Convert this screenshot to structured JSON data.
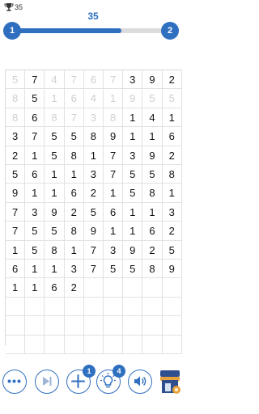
{
  "header": {
    "best_score": "35",
    "current_score": "35",
    "progress": 0.69,
    "level_left": "1",
    "level_right": "2"
  },
  "board": {
    "rows": [
      [
        [
          "5",
          0
        ],
        [
          "7",
          1
        ],
        [
          "4",
          0
        ],
        [
          "7",
          0
        ],
        [
          "6",
          0
        ],
        [
          "7",
          0
        ],
        [
          "3",
          1
        ],
        [
          "9",
          1
        ],
        [
          "2",
          1
        ]
      ],
      [
        [
          "8",
          0
        ],
        [
          "5",
          1
        ],
        [
          "1",
          0
        ],
        [
          "6",
          0
        ],
        [
          "4",
          0
        ],
        [
          "1",
          0
        ],
        [
          "9",
          0
        ],
        [
          "5",
          0
        ],
        [
          "5",
          0
        ]
      ],
      [
        [
          "8",
          0
        ],
        [
          "6",
          1
        ],
        [
          "8",
          0
        ],
        [
          "7",
          0
        ],
        [
          "3",
          0
        ],
        [
          "8",
          0
        ],
        [
          "1",
          1
        ],
        [
          "4",
          1
        ],
        [
          "1",
          1
        ]
      ],
      [
        [
          "3",
          1
        ],
        [
          "7",
          1
        ],
        [
          "5",
          1
        ],
        [
          "5",
          1
        ],
        [
          "8",
          1
        ],
        [
          "9",
          1
        ],
        [
          "1",
          1
        ],
        [
          "1",
          1
        ],
        [
          "6",
          1
        ]
      ],
      [
        [
          "2",
          1
        ],
        [
          "1",
          1
        ],
        [
          "5",
          1
        ],
        [
          "8",
          1
        ],
        [
          "1",
          1
        ],
        [
          "7",
          1
        ],
        [
          "3",
          1
        ],
        [
          "9",
          1
        ],
        [
          "2",
          1
        ]
      ],
      [
        [
          "5",
          1
        ],
        [
          "6",
          1
        ],
        [
          "1",
          1
        ],
        [
          "1",
          1
        ],
        [
          "3",
          1
        ],
        [
          "7",
          1
        ],
        [
          "5",
          1
        ],
        [
          "5",
          1
        ],
        [
          "8",
          1
        ]
      ],
      [
        [
          "9",
          1
        ],
        [
          "1",
          1
        ],
        [
          "1",
          1
        ],
        [
          "6",
          1
        ],
        [
          "2",
          1
        ],
        [
          "1",
          1
        ],
        [
          "5",
          1
        ],
        [
          "8",
          1
        ],
        [
          "1",
          1
        ]
      ],
      [
        [
          "7",
          1
        ],
        [
          "3",
          1
        ],
        [
          "9",
          1
        ],
        [
          "2",
          1
        ],
        [
          "5",
          1
        ],
        [
          "6",
          1
        ],
        [
          "1",
          1
        ],
        [
          "1",
          1
        ],
        [
          "3",
          1
        ]
      ],
      [
        [
          "7",
          1
        ],
        [
          "5",
          1
        ],
        [
          "5",
          1
        ],
        [
          "8",
          1
        ],
        [
          "9",
          1
        ],
        [
          "1",
          1
        ],
        [
          "1",
          1
        ],
        [
          "6",
          1
        ],
        [
          "2",
          1
        ]
      ],
      [
        [
          "1",
          1
        ],
        [
          "5",
          1
        ],
        [
          "8",
          1
        ],
        [
          "1",
          1
        ],
        [
          "7",
          1
        ],
        [
          "3",
          1
        ],
        [
          "9",
          1
        ],
        [
          "2",
          1
        ],
        [
          "5",
          1
        ]
      ],
      [
        [
          "6",
          1
        ],
        [
          "1",
          1
        ],
        [
          "1",
          1
        ],
        [
          "3",
          1
        ],
        [
          "7",
          1
        ],
        [
          "5",
          1
        ],
        [
          "5",
          1
        ],
        [
          "8",
          1
        ],
        [
          "9",
          1
        ]
      ],
      [
        [
          "1",
          1
        ],
        [
          "1",
          1
        ],
        [
          "6",
          1
        ],
        [
          "2",
          1
        ]
      ],
      [],
      [],
      []
    ]
  },
  "toolbar": {
    "add_badge": "1",
    "hint_badge": "4"
  },
  "colors": {
    "accent": "#2f6fbf",
    "faded_digit": "#cfcfcf"
  }
}
